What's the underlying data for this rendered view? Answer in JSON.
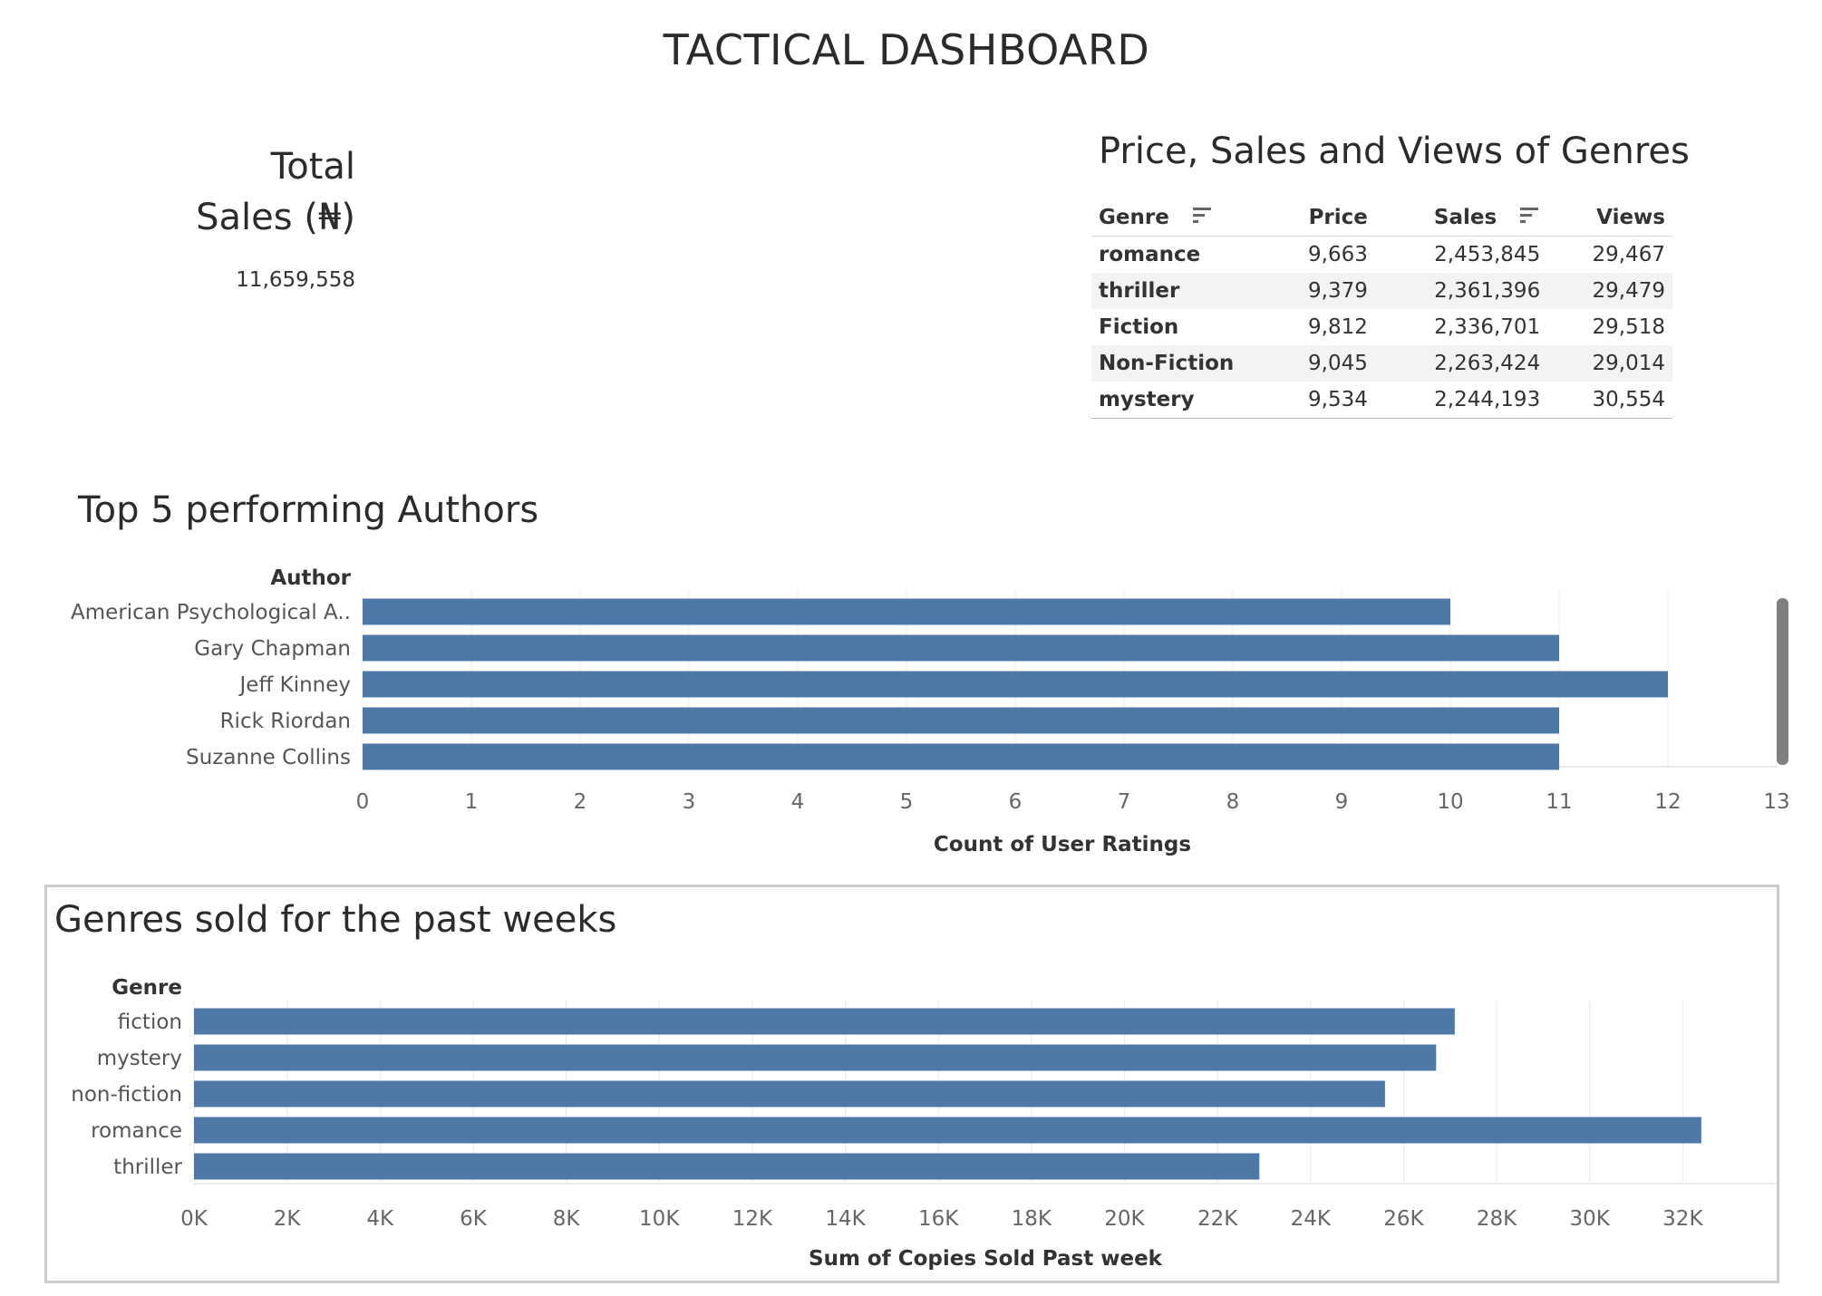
{
  "dashboard": {
    "title": "TACTICAL DASHBOARD"
  },
  "kpi": {
    "title_line1": "Total",
    "title_line2": "Sales (₦)",
    "value": "11,659,558"
  },
  "genre_table": {
    "title": "Price, Sales and Views of Genres",
    "headers": {
      "genre": "Genre",
      "price": "Price",
      "sales": "Sales",
      "views": "Views"
    },
    "rows": [
      {
        "genre": "romance",
        "price": "9,663",
        "sales": "2,453,845",
        "views": "29,467"
      },
      {
        "genre": "thriller",
        "price": "9,379",
        "sales": "2,361,396",
        "views": "29,479"
      },
      {
        "genre": "Fiction",
        "price": "9,812",
        "sales": "2,336,701",
        "views": "29,518"
      },
      {
        "genre": "Non-Fiction",
        "price": "9,045",
        "sales": "2,263,424",
        "views": "29,014"
      },
      {
        "genre": "mystery",
        "price": "9,534",
        "sales": "2,244,193",
        "views": "30,554"
      }
    ]
  },
  "chart_data": [
    {
      "type": "bar",
      "orientation": "horizontal",
      "title": "Top 5 performing Authors",
      "category_label": "Author",
      "categories": [
        "American Psychological A..",
        "Gary Chapman",
        "Jeff Kinney",
        "Rick Riordan",
        "Suzanne Collins"
      ],
      "values": [
        10,
        11,
        12,
        11,
        11
      ],
      "xlabel": "Count of User Ratings",
      "xlim": [
        0,
        13
      ],
      "ticks": [
        "0",
        "1",
        "2",
        "3",
        "4",
        "5",
        "6",
        "7",
        "8",
        "9",
        "10",
        "11",
        "12",
        "13"
      ],
      "color": "#4e79a7",
      "grid": true
    },
    {
      "type": "bar",
      "orientation": "horizontal",
      "title": "Genres sold for the past weeks",
      "category_label": "Genre",
      "categories": [
        "fiction",
        "mystery",
        "non-fiction",
        "romance",
        "thriller"
      ],
      "values": [
        27100,
        26700,
        25600,
        32400,
        22900
      ],
      "xlabel": "Sum of Copies Sold Past week",
      "xlim": [
        0,
        34000
      ],
      "ticks": [
        "0K",
        "2K",
        "4K",
        "6K",
        "8K",
        "10K",
        "12K",
        "14K",
        "16K",
        "18K",
        "20K",
        "22K",
        "24K",
        "26K",
        "28K",
        "30K",
        "32K"
      ],
      "color": "#4e79a7",
      "grid": true
    }
  ]
}
